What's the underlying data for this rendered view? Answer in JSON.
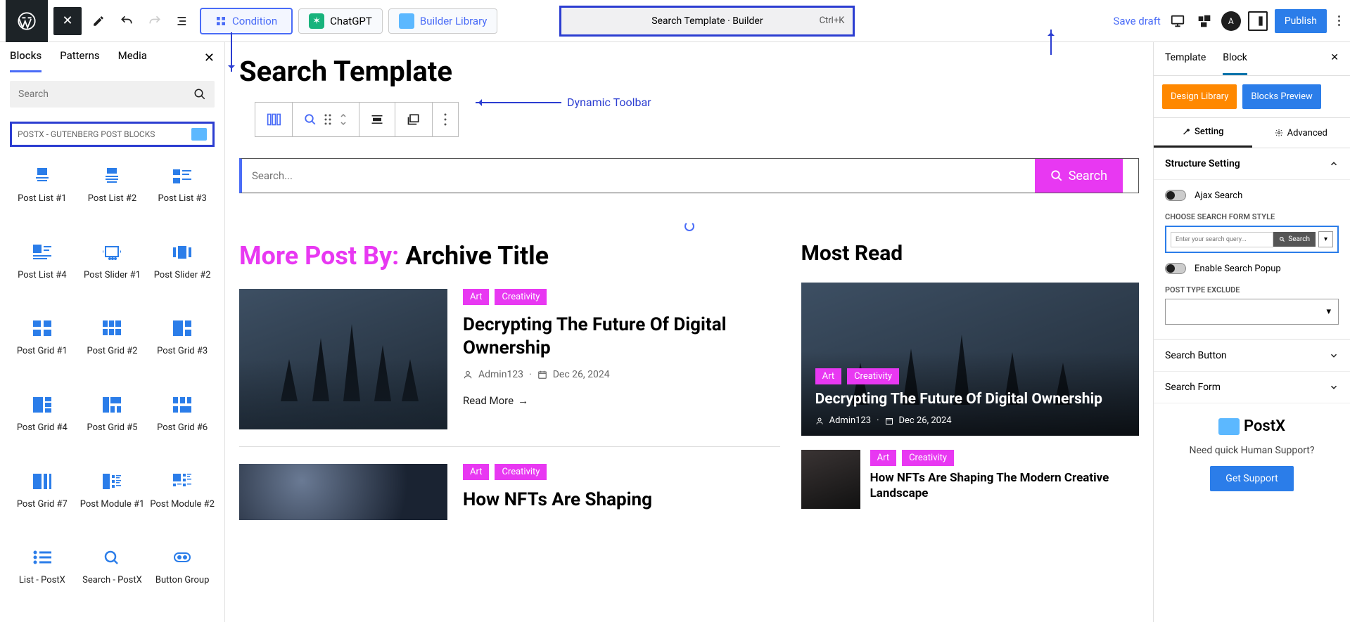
{
  "top": {
    "condition": "Condition",
    "chatgpt": "ChatGPT",
    "builder_library": "Builder Library",
    "template_name": "Search Template · Builder",
    "shortcut": "Ctrl+K",
    "save_draft": "Save draft",
    "publish": "Publish"
  },
  "annotations": {
    "dynamic_toolbar": "Dynamic Toolbar"
  },
  "inserter": {
    "tabs": [
      "Blocks",
      "Patterns",
      "Media"
    ],
    "search_placeholder": "Search",
    "section_title": "POSTX - GUTENBERG POST BLOCKS",
    "blocks": [
      "Post List #1",
      "Post List #2",
      "Post List #3",
      "Post List #4",
      "Post Slider #1",
      "Post Slider #2",
      "Post Grid #1",
      "Post Grid #2",
      "Post Grid #3",
      "Post Grid #4",
      "Post Grid #5",
      "Post Grid #6",
      "Post Grid #7",
      "Post Module #1",
      "Post Module #2",
      "List - PostX",
      "Search - PostX",
      "Button Group"
    ]
  },
  "canvas": {
    "title": "Search Template",
    "search_placeholder": "Search...",
    "search_button": "Search",
    "more_post_prefix": "More Post By: ",
    "more_post_suffix": "Archive Title",
    "most_read": "Most Read",
    "tags": {
      "art": "Art",
      "creativity": "Creativity"
    },
    "post1": {
      "title": "Decrypting The Future Of Digital Ownership",
      "author": "Admin123",
      "date": "Dec 26, 2024",
      "read_more": "Read More"
    },
    "post2": {
      "title": "How NFTs Are Shaping"
    },
    "mr1": {
      "title": "Decrypting The Future Of Digital Ownership",
      "author": "Admin123",
      "date": "Dec 26, 2024"
    },
    "mr2": {
      "title": "How NFTs Are Shaping The Modern Creative Landscape"
    }
  },
  "settings": {
    "tabs": [
      "Template",
      "Block"
    ],
    "design_library": "Design Library",
    "blocks_preview": "Blocks Preview",
    "subtabs": [
      "Setting",
      "Advanced"
    ],
    "structure_setting": "Structure Setting",
    "ajax_search": "Ajax Search",
    "choose_style": "CHOOSE SEARCH FORM STYLE",
    "style_placeholder": "Enter your search query...",
    "style_button": "Search",
    "enable_popup": "Enable Search Popup",
    "post_type_exclude": "POST TYPE EXCLUDE",
    "search_button": "Search Button",
    "search_form": "Search Form",
    "postx": "PostX",
    "support_text": "Need quick Human Support?",
    "get_support": "Get Support"
  }
}
